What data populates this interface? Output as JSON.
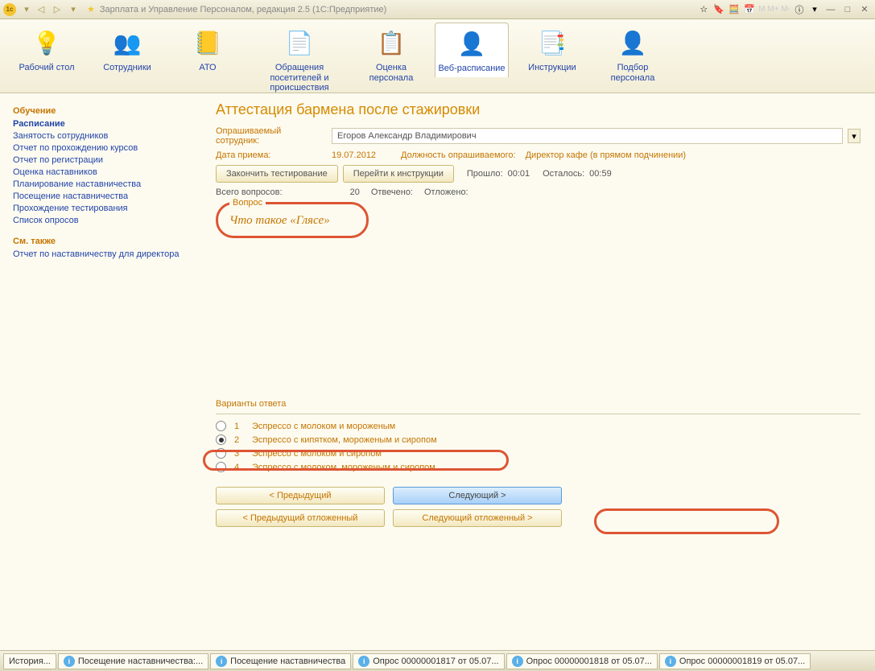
{
  "titlebar": {
    "title": "Зарплата и Управление Персоналом, редакция 2.5  (1С:Предприятие)",
    "memory_labels": "M  M+  M-"
  },
  "toolbar": [
    {
      "label": "Рабочий стол",
      "icon": "💡"
    },
    {
      "label": "Сотрудники",
      "icon": "👥"
    },
    {
      "label": "АТО",
      "icon": "📒"
    },
    {
      "label": "Обращения посетителей и происшествия",
      "icon": "📄"
    },
    {
      "label": "Оценка персонала",
      "icon": "📋"
    },
    {
      "label": "Веб-расписание",
      "icon": "👤"
    },
    {
      "label": "Инструкции",
      "icon": "📑"
    },
    {
      "label": "Подбор персонала",
      "icon": "👤"
    }
  ],
  "sidebar": {
    "head1": "Обучение",
    "links1": [
      "Расписание",
      "Занятость сотрудников",
      "Отчет по прохождению курсов",
      "Отчет по регистрации",
      "Оценка наставников",
      "Планирование наставничества",
      "Посещение наставничества",
      "Прохождение тестирования",
      "Список опросов"
    ],
    "head2": "См. также",
    "links2": [
      "Отчет по наставничеству для директора"
    ]
  },
  "main": {
    "title": "Аттестация бармена после стажировки",
    "emp_label": "Опрашиваемый сотрудник:",
    "emp_value": "Егоров Александр Владимирович",
    "hire_label": "Дата приема:",
    "hire_value": "19.07.2012",
    "pos_label": "Должность опрашиваемого:",
    "pos_value": "Директор кафе (в прямом подчинении)",
    "btn_finish": "Закончить тестирование",
    "btn_instr": "Перейти к инструкции",
    "elapsed_label": "Прошло:",
    "elapsed_value": "00:01",
    "remain_label": "Осталось:",
    "remain_value": "00:59",
    "total_label": "Всего вопросов:",
    "total_value": "20",
    "answered_label": "Отвечено:",
    "deferred_label": "Отложено:",
    "question_legend": "Вопрос",
    "question_text": "Что такое «Глясе»",
    "answers_legend": "Варианты ответа",
    "answers": [
      {
        "n": "1",
        "text": "Эспрессо с молоком и мороженым",
        "sel": false
      },
      {
        "n": "2",
        "text": "Эспрессо с кипятком, мороженым и сиропом",
        "sel": true
      },
      {
        "n": "3",
        "text": "Эспрессо с молоком и сиропом",
        "sel": false
      },
      {
        "n": "4",
        "text": "Эспрессо с молоком, мороженым и сиропом",
        "sel": false
      }
    ],
    "btn_prev": "< Предыдущий",
    "btn_next": "Следующий >",
    "btn_prev_def": "< Предыдущий отложенный",
    "btn_next_def": "Следующий отложенный >"
  },
  "statusbar": {
    "history": "История...",
    "items": [
      "Посещение наставничества:...",
      "Посещение наставничества",
      "Опрос 00000001817 от 05.07...",
      "Опрос 00000001818 от 05.07...",
      "Опрос 00000001819 от 05.07..."
    ]
  }
}
